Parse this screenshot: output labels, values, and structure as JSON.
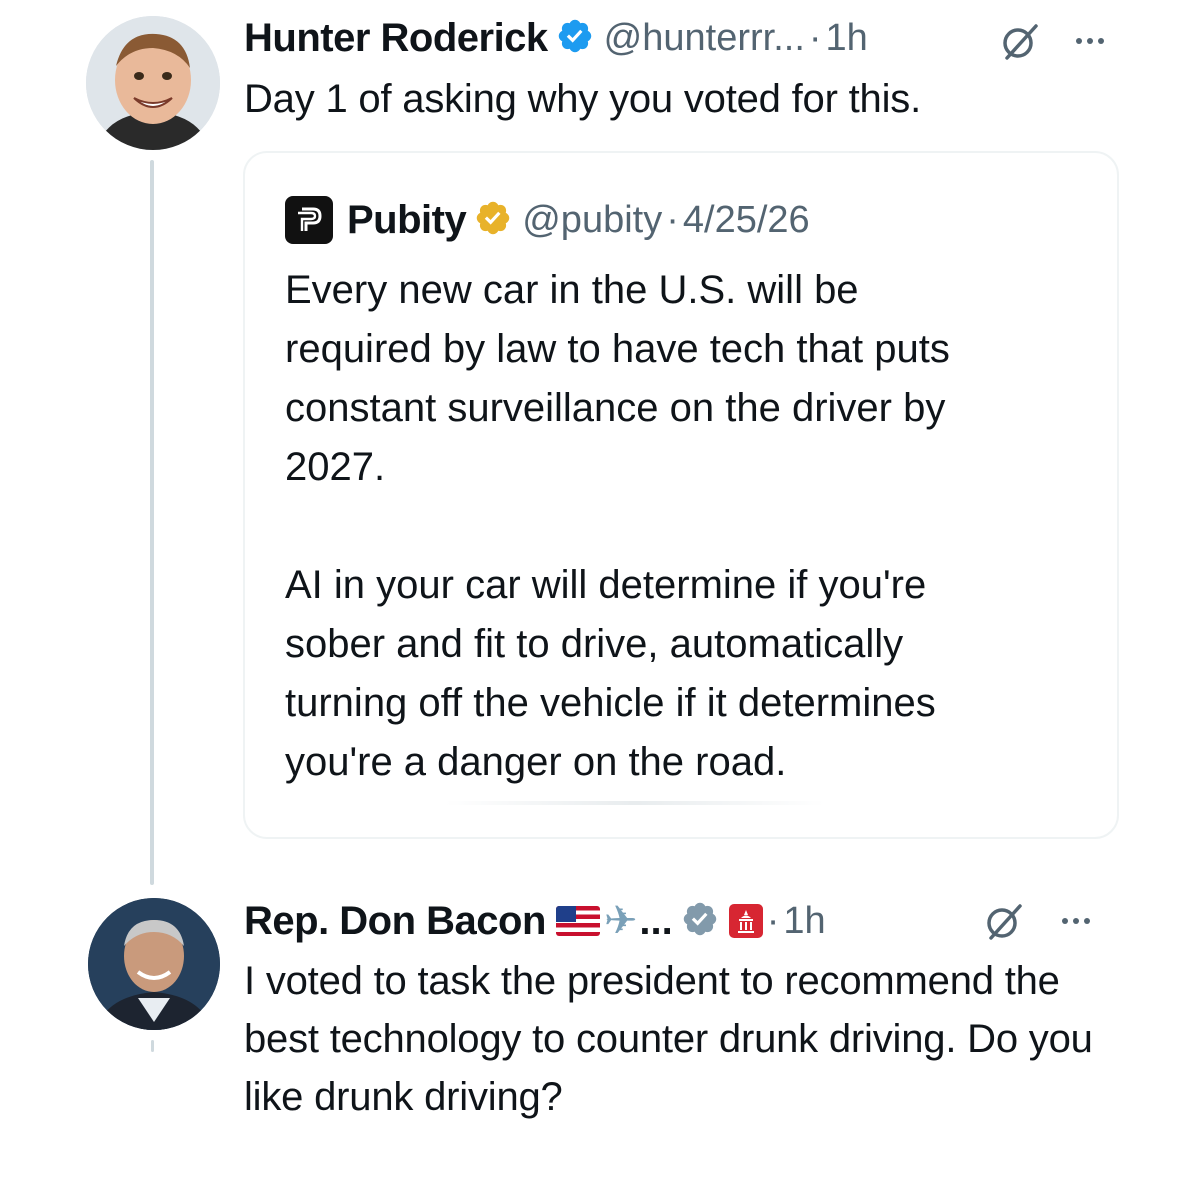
{
  "tweet1": {
    "name": "Hunter Roderick",
    "handle": "@hunterrr...",
    "dot": "·",
    "time": "1h",
    "text": "Day 1 of asking why you voted for this.",
    "verified_color": "#1d9bf0"
  },
  "quote": {
    "name": "Pubity",
    "handle": "@pubity",
    "dot": "·",
    "date": "4/25/26",
    "logo_letter": "P",
    "verified_color": "#e8b22a",
    "paragraph1": "Every new car in the U.S. will be\nrequired by law to have tech that puts\nconstant surveillance on the driver by\n2027.",
    "paragraph2": "AI in your car will determine if you're\nsober and fit to drive, automatically\nturning off the vehicle if it determines\nyou're a danger on the road."
  },
  "tweet2": {
    "name": "Rep. Don Bacon",
    "ellipsis": "...",
    "dot": "·",
    "time": "1h",
    "text": "I voted to task the president to recommend the best technology to counter drunk driving. Do you like drunk driving?",
    "verified_color": "#829aab",
    "affiliate_color": "#d72632"
  },
  "icons": {
    "verified": "verified-badge-icon",
    "grok": "grok-icon",
    "more": "more-options-icon",
    "flag": "us-flag-emoji",
    "plane": "airplane-emoji",
    "affiliate": "capitol-affiliate-icon"
  }
}
